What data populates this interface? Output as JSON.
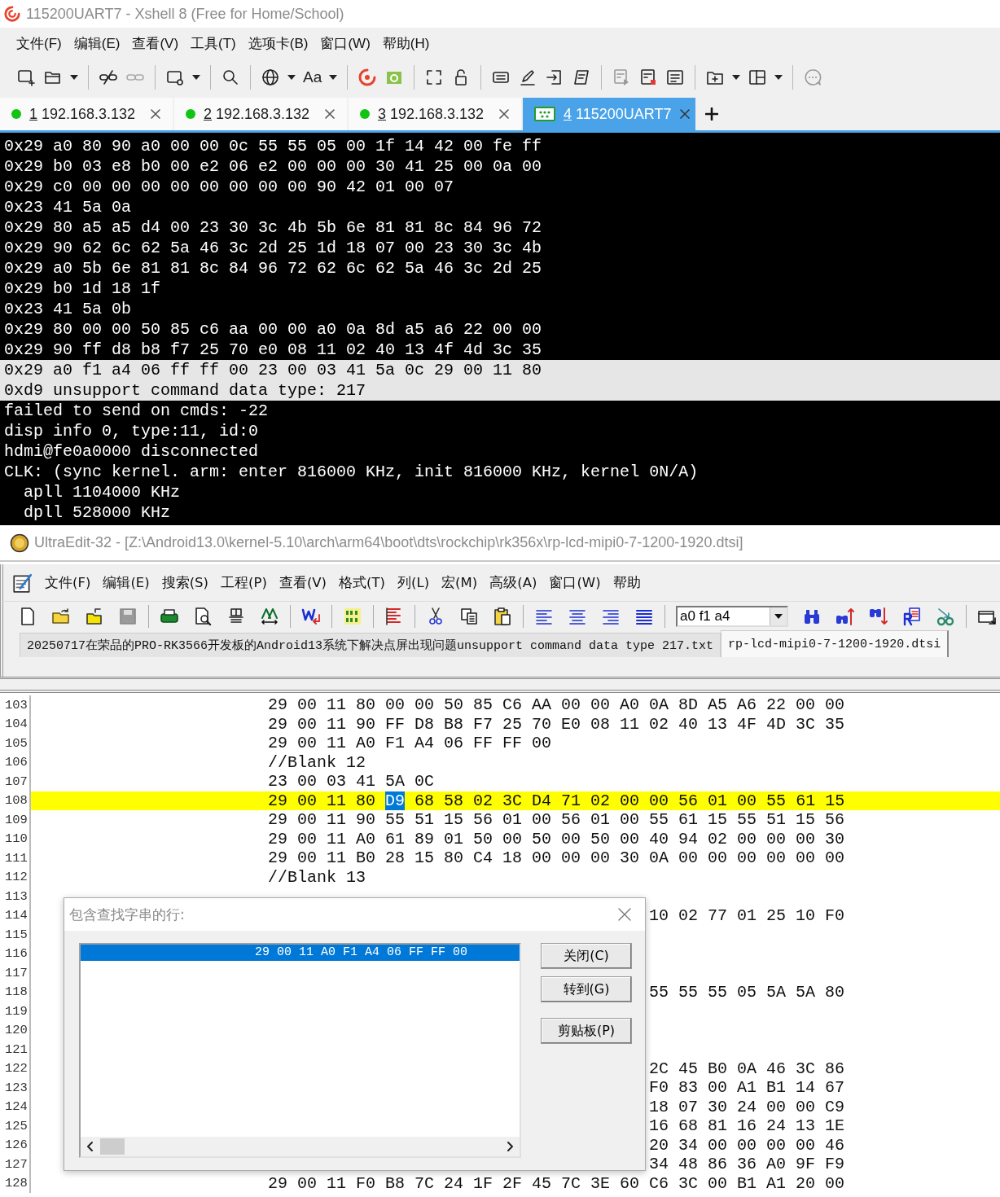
{
  "xshell": {
    "window": {
      "title": "115200UART7 - Xshell 8 (Free for Home/School)"
    },
    "menu": [
      "文件(F)",
      "编辑(E)",
      "查看(V)",
      "工具(T)",
      "选项卡(B)",
      "窗口(W)",
      "帮助(H)"
    ],
    "toolbar": {
      "font_button": "Aa"
    },
    "tabs": [
      {
        "number": "1",
        "label": "192.168.3.132",
        "kind": "ssh",
        "color": "#11c411",
        "selected": false
      },
      {
        "number": "2",
        "label": "192.168.3.132",
        "kind": "ssh",
        "color": "#11c411",
        "selected": false
      },
      {
        "number": "3",
        "label": "192.168.3.132",
        "kind": "ssh",
        "color": "#11c411",
        "selected": false
      },
      {
        "number": "4",
        "label": "115200UART7",
        "kind": "serial",
        "color": "#1f9e2a",
        "selected": true
      }
    ],
    "terminal": {
      "lines": [
        {
          "text": "0x29 a0 80 90 a0 00 00 0c 55 55 05 00 1f 14 42 00 fe ff",
          "selected": false
        },
        {
          "text": "0x29 b0 03 e8 b0 00 e2 06 e2 00 00 00 30 41 25 00 0a 00",
          "selected": false
        },
        {
          "text": "0x29 c0 00 00 00 00 00 00 00 00 90 42 01 00 07",
          "selected": false
        },
        {
          "text": "0x23 41 5a 0a",
          "selected": false
        },
        {
          "text": "0x29 80 a5 a5 d4 00 23 30 3c 4b 5b 6e 81 81 8c 84 96 72",
          "selected": false
        },
        {
          "text": "0x29 90 62 6c 62 5a 46 3c 2d 25 1d 18 07 00 23 30 3c 4b",
          "selected": false
        },
        {
          "text": "0x29 a0 5b 6e 81 81 8c 84 96 72 62 6c 62 5a 46 3c 2d 25",
          "selected": false
        },
        {
          "text": "0x29 b0 1d 18 1f",
          "selected": false
        },
        {
          "text": "0x23 41 5a 0b",
          "selected": false
        },
        {
          "text": "0x29 80 00 00 50 85 c6 aa 00 00 a0 0a 8d a5 a6 22 00 00",
          "selected": false
        },
        {
          "text": "0x29 90 ff d8 b8 f7 25 70 e0 08 11 02 40 13 4f 4d 3c 35",
          "selected": false
        },
        {
          "text": "0x29 a0 f1 a4 06 ff ff 00 23 00 03 41 5a 0c 29 00 11 80",
          "selected": true
        },
        {
          "text": "0xd9 unsupport command data type: 217",
          "selected": true
        },
        {
          "text": "failed to send on cmds: -22",
          "selected": false
        },
        {
          "text": "disp info 0, type:11, id:0",
          "selected": false
        },
        {
          "text": "hdmi@fe0a0000 disconnected",
          "selected": false
        },
        {
          "text": "CLK: (sync kernel. arm: enter 816000 KHz, init 816000 KHz, kernel 0N/A)",
          "selected": false
        },
        {
          "text": "  apll 1104000 KHz",
          "selected": false
        },
        {
          "text": "  dpll 528000 KHz",
          "selected": false
        }
      ]
    }
  },
  "ultraedit": {
    "window": {
      "title": "UltraEdit-32 - [Z:\\Android13.0\\kernel-5.10\\arch\\arm64\\boot\\dts\\rockchip\\rk356x\\rp-lcd-mipi0-7-1200-1920.dtsi]"
    },
    "menu": [
      "文件(F)",
      "编辑(E)",
      "搜索(S)",
      "工程(P)",
      "查看(V)",
      "格式(T)",
      "列(L)",
      "宏(M)",
      "高级(A)",
      "窗口(W)",
      "帮助"
    ],
    "search": {
      "value": "a0 f1 a4"
    },
    "file_tabs": [
      {
        "label": "20250717在荣品的PRO-RK3566开发板的Android13系统下解决点屏出现问题unsupport command data type 217.txt",
        "selected": false
      },
      {
        "label": "rp-lcd-mipi0-7-1200-1920.dtsi",
        "selected": true
      }
    ],
    "editor": {
      "lines": [
        {
          "number": "103",
          "kind": "code",
          "current": false,
          "text": "29 00 11 80 00 00 50 85 C6 AA 00 00 A0 0A 8D A5 A6 22 00 00"
        },
        {
          "number": "104",
          "kind": "code",
          "current": false,
          "text": "29 00 11 90 FF D8 B8 F7 25 70 E0 08 11 02 40 13 4F 4D 3C 35"
        },
        {
          "number": "105",
          "kind": "code",
          "current": false,
          "text": "29 00 11 A0 F1 A4 06 FF FF 00"
        },
        {
          "number": "106",
          "kind": "code",
          "current": false,
          "text": "//Blank 12"
        },
        {
          "number": "107",
          "kind": "code",
          "current": false,
          "text": "23 00 03 41 5A 0C"
        },
        {
          "number": "108",
          "kind": "code",
          "current": true,
          "parts": [
            {
              "text": "29 00 11 80 ",
              "selected": false
            },
            {
              "text": "D9",
              "selected": true
            },
            {
              "text": " 68 58 02 3C D4 71 02 00 00 56 01 00 55 61 15",
              "selected": false
            }
          ]
        },
        {
          "number": "109",
          "kind": "code",
          "current": false,
          "text": "29 00 11 90 55 51 15 56 01 00 56 01 00 55 61 15 55 51 15 56"
        },
        {
          "number": "110",
          "kind": "code",
          "current": false,
          "text": "29 00 11 A0 61 89 01 50 00 50 00 50 00 40 94 02 00 00 00 30"
        },
        {
          "number": "111",
          "kind": "code",
          "current": false,
          "text": "29 00 11 B0 28 15 80 C4 18 00 00 00 30 0A 00 00 00 00 00 00"
        },
        {
          "number": "112",
          "kind": "code",
          "current": false,
          "text": "//Blank 13"
        },
        {
          "number": "113",
          "kind": "tail",
          "current": false
        },
        {
          "number": "114",
          "kind": "tail",
          "current": false,
          "text": "10 02 77 01 25 10 F0"
        },
        {
          "number": "115",
          "kind": "tail",
          "current": false
        },
        {
          "number": "116",
          "kind": "tail",
          "current": false
        },
        {
          "number": "117",
          "kind": "tail",
          "current": false
        },
        {
          "number": "118",
          "kind": "tail",
          "current": false,
          "text": "55 55 55 05 5A 5A 80"
        },
        {
          "number": "119",
          "kind": "tail",
          "current": false
        },
        {
          "number": "120",
          "kind": "tail",
          "current": false
        },
        {
          "number": "121",
          "kind": "tail",
          "current": false
        },
        {
          "number": "122",
          "kind": "tail",
          "current": false,
          "text": "2C 45 B0 0A 46 3C 86"
        },
        {
          "number": "123",
          "kind": "tail",
          "current": false,
          "text": "F0 83 00 A1 B1 14 67"
        },
        {
          "number": "124",
          "kind": "tail",
          "current": false,
          "text": "18 07 30 24 00 00 C9"
        },
        {
          "number": "125",
          "kind": "tail",
          "current": false,
          "text": "16 68 81 16 24 13 1E"
        },
        {
          "number": "126",
          "kind": "tail",
          "current": false,
          "text": "20 34 00 00 00 00 46"
        },
        {
          "number": "127",
          "kind": "tail",
          "current": false,
          "text": "34 48 86 36 A0 9F F9"
        },
        {
          "number": "128",
          "kind": "code",
          "current": false,
          "text": "29 00 11 F0 B8 7C 24 1F 2F 45 7C 3E 60 C6 3C 00 B1 A1 20 00"
        }
      ]
    },
    "find_dialog": {
      "title": "包含查找字串的行:",
      "results": [
        {
          "text": "29 00 11 A0 F1 A4 06 FF FF 00",
          "selected": true
        }
      ],
      "buttons": [
        "关闭(C)",
        "转到(G)",
        "剪贴板(P)"
      ]
    }
  }
}
